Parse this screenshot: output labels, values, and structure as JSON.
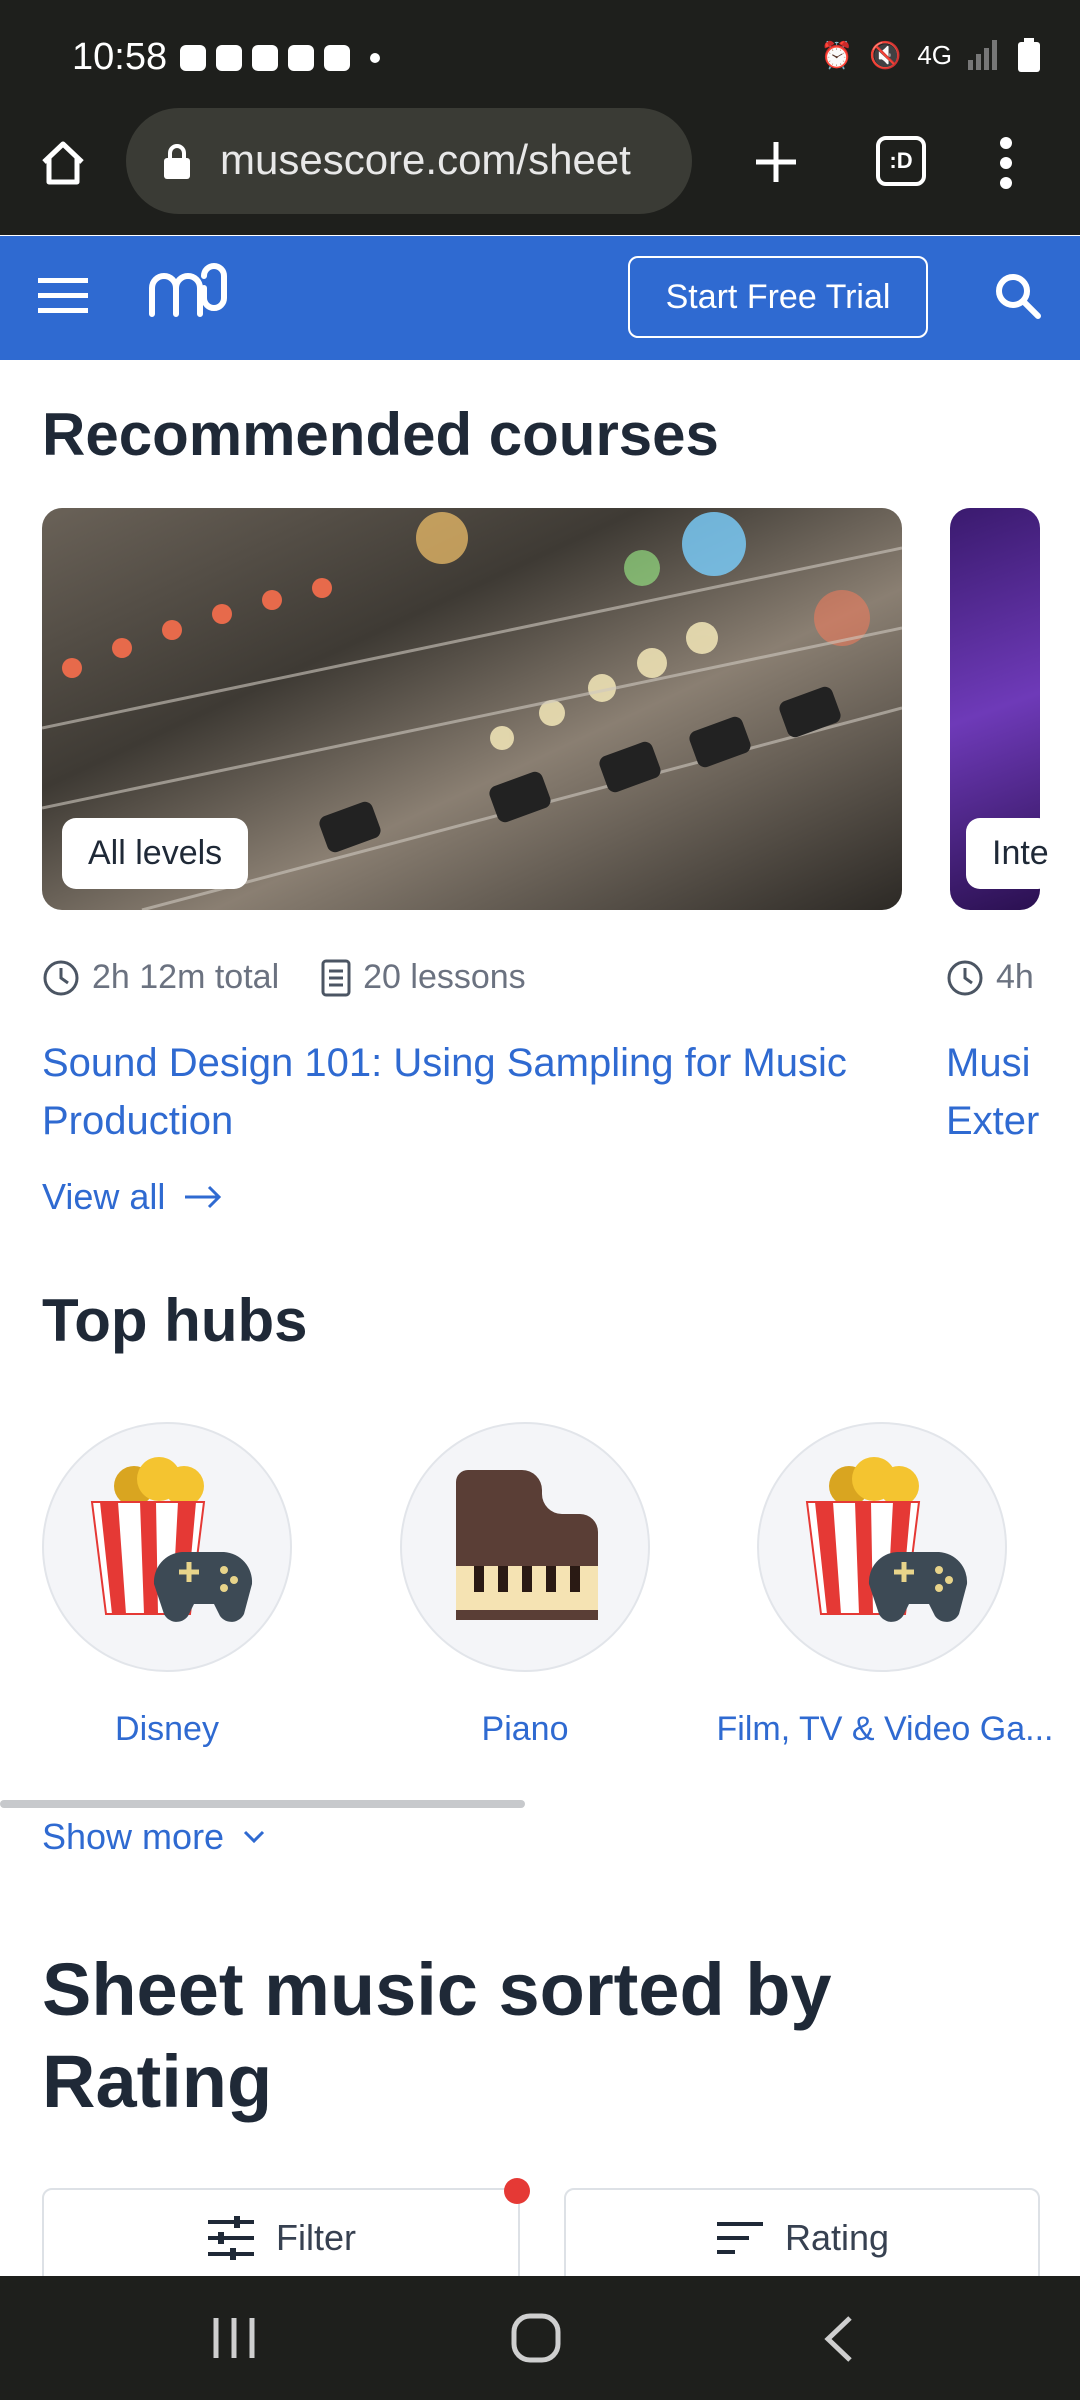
{
  "status_bar": {
    "time": "10:58",
    "network": "4G"
  },
  "browser": {
    "url": "musescore.com/sheet",
    "tab_badge": ":D"
  },
  "header": {
    "cta_label": "Start Free Trial"
  },
  "courses": {
    "heading": "Recommended courses",
    "items": [
      {
        "level": "All levels",
        "duration": "2h 12m total",
        "lessons": "20 lessons",
        "title": "Sound Design 101: Using Sampling for Music Production"
      },
      {
        "level": "Inte",
        "duration": "4h",
        "title": "Musi Exter"
      }
    ],
    "view_all": "View all"
  },
  "hubs": {
    "heading": "Top hubs",
    "items": [
      {
        "label": "Disney",
        "icon": "popcorn-gamepad-icon"
      },
      {
        "label": "Piano",
        "icon": "grand-piano-icon"
      },
      {
        "label": "Film, TV & Video Ga...",
        "icon": "popcorn-gamepad-icon"
      }
    ],
    "show_more": "Show more"
  },
  "sheet": {
    "heading_line1": "Sheet music sorted by",
    "heading_line2": "Rating",
    "filter_label": "Filter",
    "sort_label": "Rating"
  },
  "colors": {
    "brand": "#2f6ad1",
    "dark": "#1e1f1c",
    "notification_dot": "#e53935"
  }
}
